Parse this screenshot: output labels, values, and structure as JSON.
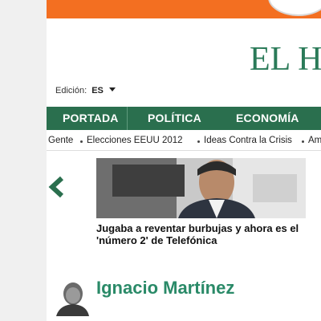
{
  "header": {
    "masthead": "EL H",
    "edition_label": "Edición:",
    "edition_value": "ES"
  },
  "nav": {
    "items": [
      "PORTADA",
      "POLÍTICA",
      "ECONOMÍA"
    ]
  },
  "subnav": {
    "items": [
      "Gente",
      "Elecciones EEUU 2012",
      "Ideas Contra la Crisis",
      "Am"
    ]
  },
  "carousel": {
    "prev_icon": "chevron-left-icon",
    "headline": "Jugaba a reventar burbujas y ahora es el 'número 2' de Telefónica"
  },
  "author": {
    "name": "Ignacio Martínez"
  },
  "colors": {
    "brand_green": "#2a6f4e",
    "banner_orange": "#f36f21",
    "author_green": "#2a8a68"
  }
}
